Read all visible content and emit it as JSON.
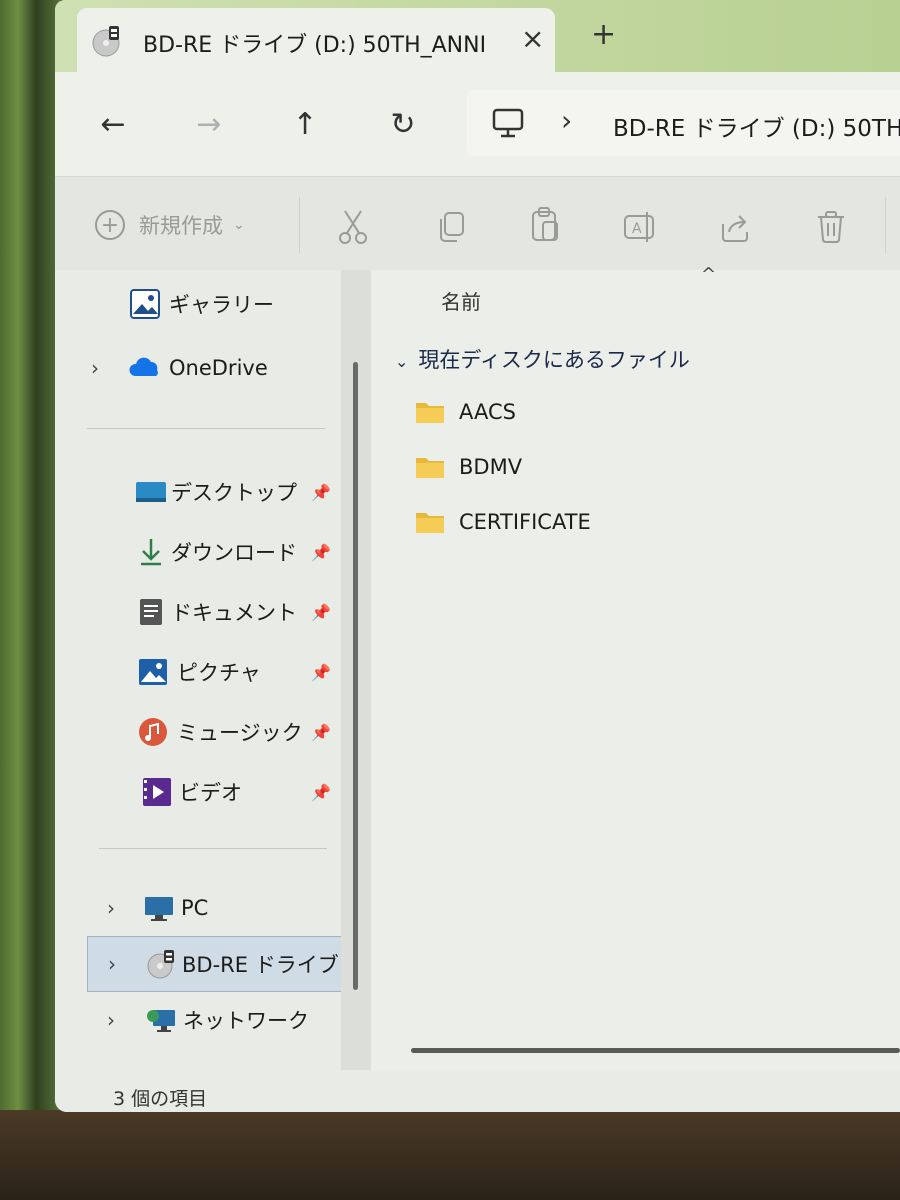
{
  "tab": {
    "title": "BD-RE ドライブ (D:) 50TH_ANNI",
    "close_icon": "×",
    "new_tab_icon": "+"
  },
  "nav": {
    "back": "←",
    "forward": "→",
    "up": "↑",
    "refresh": "↻"
  },
  "address": {
    "separator": "›",
    "path_text": "BD-RE ドライブ (D:) 50TH"
  },
  "command_bar": {
    "new_label": "新規作成",
    "new_dropdown": "⌄",
    "plus": "+"
  },
  "sidebar": {
    "expand_chevron": "›",
    "pin_icon": "📌",
    "top_items": [
      {
        "label": "ギャラリー",
        "icon": "gallery-icon"
      },
      {
        "label": "OneDrive",
        "icon": "onedrive-icon"
      }
    ],
    "quick_access": [
      {
        "label": "デスクトップ",
        "icon": "desktop-icon"
      },
      {
        "label": "ダウンロード",
        "icon": "download-icon"
      },
      {
        "label": "ドキュメント",
        "icon": "documents-icon"
      },
      {
        "label": "ピクチャ",
        "icon": "pictures-icon"
      },
      {
        "label": "ミュージック",
        "icon": "music-icon"
      },
      {
        "label": "ビデオ",
        "icon": "videos-icon"
      }
    ],
    "locations": [
      {
        "label": "PC",
        "icon": "pc-icon"
      },
      {
        "label": "BD-RE ドライブ (D",
        "icon": "disc-drive-icon"
      },
      {
        "label": "ネットワーク",
        "icon": "network-icon"
      }
    ]
  },
  "content": {
    "sort_indicator": "^",
    "column_name": "名前",
    "group_chevron": "⌄",
    "group_label": "現在ディスクにあるファイル",
    "files": [
      {
        "name": "AACS"
      },
      {
        "name": "BDMV"
      },
      {
        "name": "CERTIFICATE"
      }
    ]
  },
  "status": {
    "item_count": "3 個の項目"
  }
}
